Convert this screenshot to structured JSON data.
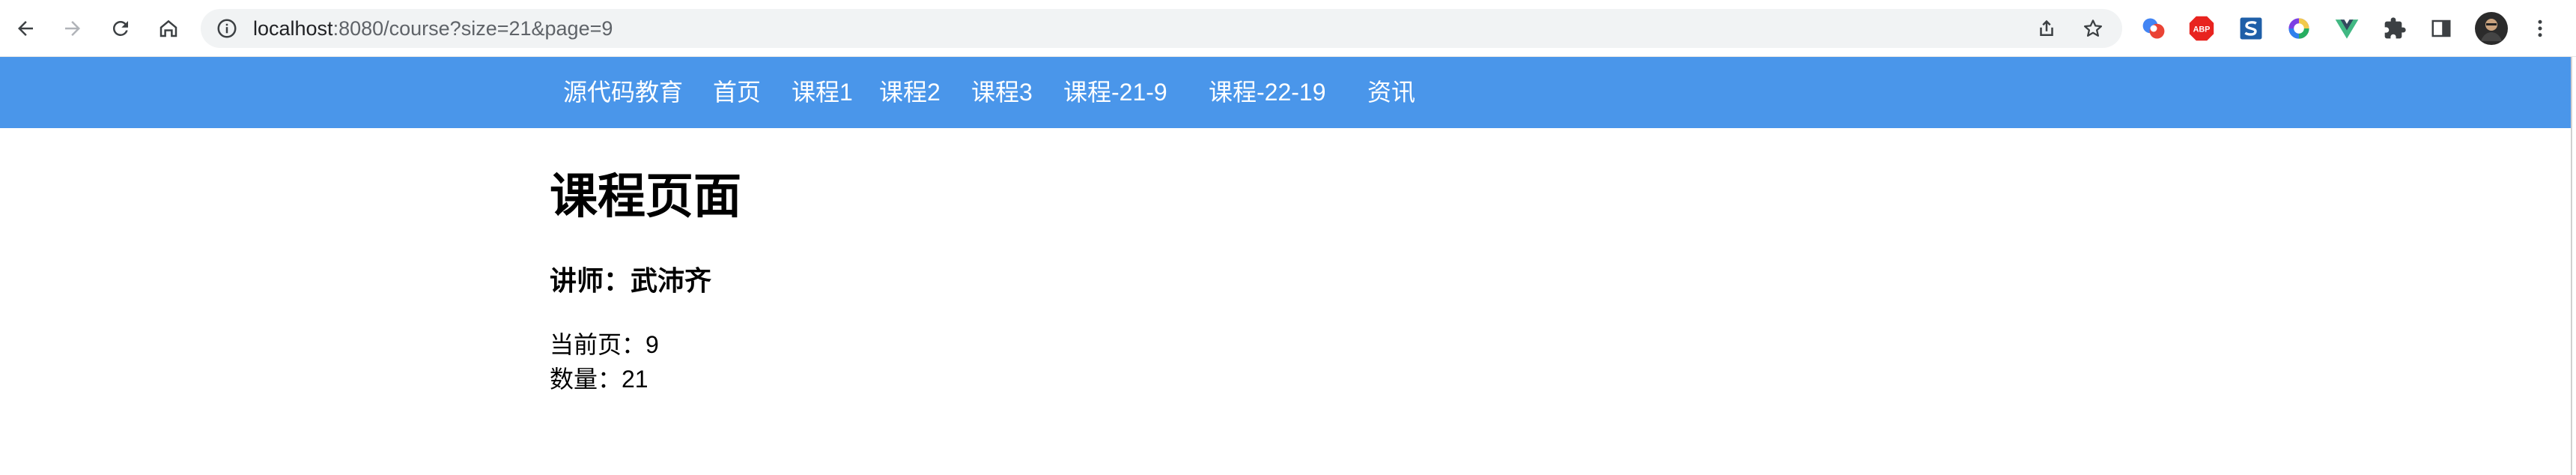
{
  "browser": {
    "url_host": "localhost",
    "url_rest": ":8080/course?size=21&page=9",
    "icons": {
      "back": "arrow-left-icon",
      "forward": "arrow-right-icon",
      "reload": "reload-icon",
      "home": "home-icon",
      "info": "info-icon",
      "share": "share-icon",
      "bookmark": "star-icon",
      "extensions": "puzzle-icon",
      "sidepanel": "side-panel-icon",
      "menu": "kebab-menu-icon"
    },
    "extensions": {
      "abp_label": "ABP"
    }
  },
  "site_nav": {
    "color": "#4a96ea",
    "items": [
      "源代码教育",
      "首页",
      "课程1",
      "课程2",
      "课程3",
      "课程-21-9",
      "课程-22-19",
      "资讯"
    ]
  },
  "page": {
    "title": "课程页面",
    "teacher": "讲师：武沛齐",
    "current_page": "当前页：9",
    "count": "数量：21"
  }
}
